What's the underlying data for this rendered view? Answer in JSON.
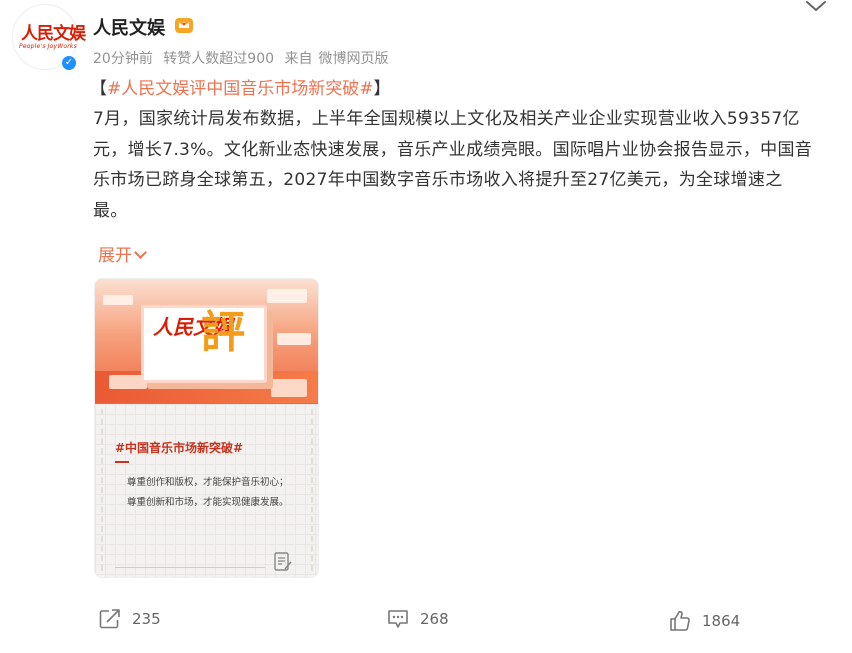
{
  "author": {
    "name": "人民文娱",
    "avatar_logo": "人民文娱",
    "avatar_sub": "People's JoyWorks",
    "verified_icon": "verified-check-icon",
    "badge_icon": "crown-badge-icon"
  },
  "meta": {
    "time": "20分钟前",
    "reposts_note": "转赞人数超过900",
    "source_prefix": "来自",
    "source": "微博网页版"
  },
  "post": {
    "bracket_open": "【",
    "topic": "#人民文娱评中国音乐市场新突破#",
    "bracket_close": "】",
    "body": "7月，国家统计局发布数据，上半年全国规模以上文化及相关产业企业实现营业收入59357亿元，增长7.3%。文化新业态快速发展，音乐产业成绩亮眼。国际唱片业协会报告显示，中国音乐市场已跻身全球第五，2027年中国数字音乐市场收入将提升至27亿美元，为全球增速之最。",
    "expand_label": "展开"
  },
  "image": {
    "logo_text": "人民文娱",
    "ping_char": "評",
    "title": "#中国音乐市场新突破#",
    "lines": [
      "尊重创作和版权，才能保护音乐初心；",
      "尊重创新和市场，才能实现健康发展。"
    ]
  },
  "actions": {
    "share_count": "235",
    "comment_count": "268",
    "like_count": "1864"
  },
  "colors": {
    "accent": "#eb7350",
    "verified": "#1e90ff",
    "brand_red": "#d81e06"
  }
}
